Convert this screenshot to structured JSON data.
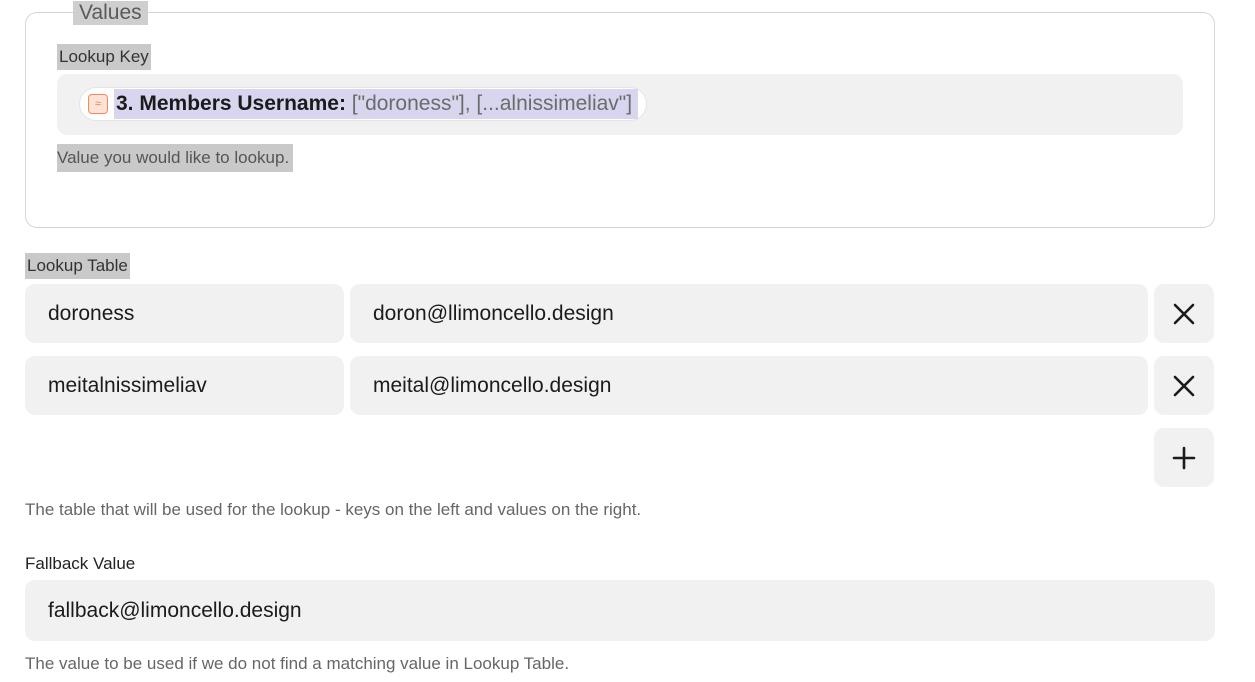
{
  "values_section": {
    "legend": "Values",
    "lookup_key": {
      "label": "Lookup Key",
      "pill_icon": "formatter-icon",
      "pill_step": "3. Members Username:",
      "pill_value": "[\"doroness\"], [...alnissimeliav\"]",
      "help": "Value you would like to lookup."
    }
  },
  "lookup_table": {
    "label": "Lookup Table",
    "rows": [
      {
        "key": "doroness",
        "value": "doron@llimoncello.design"
      },
      {
        "key": "meitalnissimeliav",
        "value": "meital@limoncello.design"
      }
    ],
    "remove_icon": "close-icon",
    "add_icon": "plus-icon",
    "help": "The table that will be used for the lookup - keys on the left and values on the right."
  },
  "fallback": {
    "label": "Fallback Value",
    "value": "fallback@limoncello.design",
    "help": "The value to be used if we do not find a matching value in Lookup Table."
  }
}
